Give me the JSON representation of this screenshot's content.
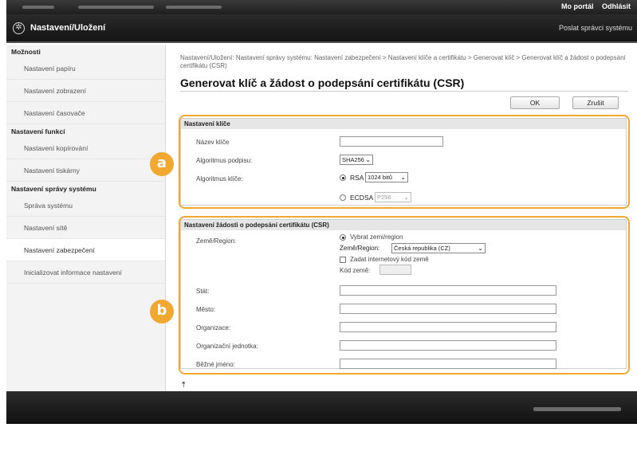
{
  "header": {
    "portal_link": "Mo portál",
    "logout_link": "Odhlásit",
    "app_title": "Nastavení/Uložení",
    "send_to_admin": "Poslat správci systému"
  },
  "sidebar": {
    "groups": [
      {
        "heading": "Možnosti",
        "items": [
          "Nastavení papíru",
          "Nastavení zobrazení",
          "Nastavení časovače"
        ]
      },
      {
        "heading": "Nastavení funkcí",
        "items": [
          "Nastavení kopírování",
          "Nastavení tiskárny"
        ]
      },
      {
        "heading": "Nastavení správy systému",
        "items": [
          "Správa systému",
          "Nastavení sítě",
          "Nastavení zabezpečení",
          "Inicializovat informace nastavení"
        ]
      }
    ],
    "active_item": "Nastavení zabezpečení"
  },
  "main": {
    "breadcrumb": "Nastavení/Uložení: Nastavení správy systému: Nastavení zabezpečení > Nastavení klíče a certifikátu > Generovat klíč > Generovat klíč a žádost o podepsání certifikátu (CSR)",
    "page_title": "Generovat klíč a žádost o podepsání certifikátu (CSR)",
    "ok_label": "OK",
    "cancel_label": "Zrušit",
    "key_section": {
      "heading": "Nastavení klíče",
      "key_name_label": "Název klíče",
      "key_name_value": "",
      "signature_algorithm_label": "Algoritmus podpisu:",
      "signature_algorithm_value": "SHA256",
      "key_algorithm_label": "Algoritmus klíče:",
      "rsa_label": "RSA",
      "rsa_bits_value": "1024 bitů",
      "ecdsa_label": "ECDSA",
      "ecdsa_value": "P256"
    },
    "csr_section": {
      "heading": "Nastavení žádosti o podepsání certifikátu (CSR)",
      "country_region_label": "Země/Region:",
      "select_country_label": "Vybrat zemi/region",
      "country_region_select_label": "Země/Region:",
      "country_region_value": "Česká republika (CZ)",
      "enter_code_label": "Zadat internetový kód země",
      "country_code_label": "Kód země:",
      "country_code_value": "",
      "state_label": "Stát:",
      "city_label": "Město:",
      "organization_label": "Organizace:",
      "org_unit_label": "Organizační jednotka:",
      "common_name_label": "Běžné jméno:"
    },
    "badge_a": "a",
    "badge_b": "b",
    "top_link": "⤒"
  },
  "colors": {
    "highlight": "#f0a830",
    "header_bg": "#1f1f1f",
    "sidebar_bg": "#f3f3f3"
  }
}
